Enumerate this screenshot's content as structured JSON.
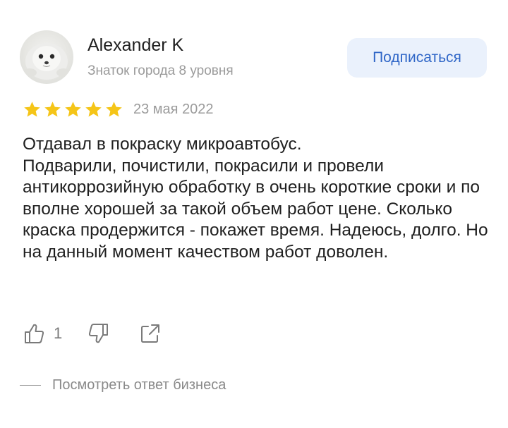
{
  "author": {
    "name": "Alexander K",
    "level": "Знаток города 8 уровня"
  },
  "subscribe_button": {
    "label": "Подписаться"
  },
  "rating": {
    "stars": 5,
    "max": 5,
    "color": "#f5c518"
  },
  "review": {
    "date": "23 мая 2022",
    "text": "Отдавал в покраску микроавтобус.\nПодварили, почистили, покрасили и провели антикоррозийную обработку в очень короткие сроки и по вполне хорошей за такой объем работ цене. Сколько краска продержится - покажет время. Надеюсь, долго. Но на данный момент качеством работ доволен."
  },
  "actions": {
    "like_count": "1",
    "like_icon": "thumbs-up-icon",
    "dislike_icon": "thumbs-down-icon",
    "share_icon": "share-icon"
  },
  "business_reply": {
    "label": "Посмотреть ответ бизнеса"
  },
  "colors": {
    "accent": "#2f66c7",
    "button_bg": "#eaf1fc",
    "muted_text": "#9b9b9b"
  }
}
